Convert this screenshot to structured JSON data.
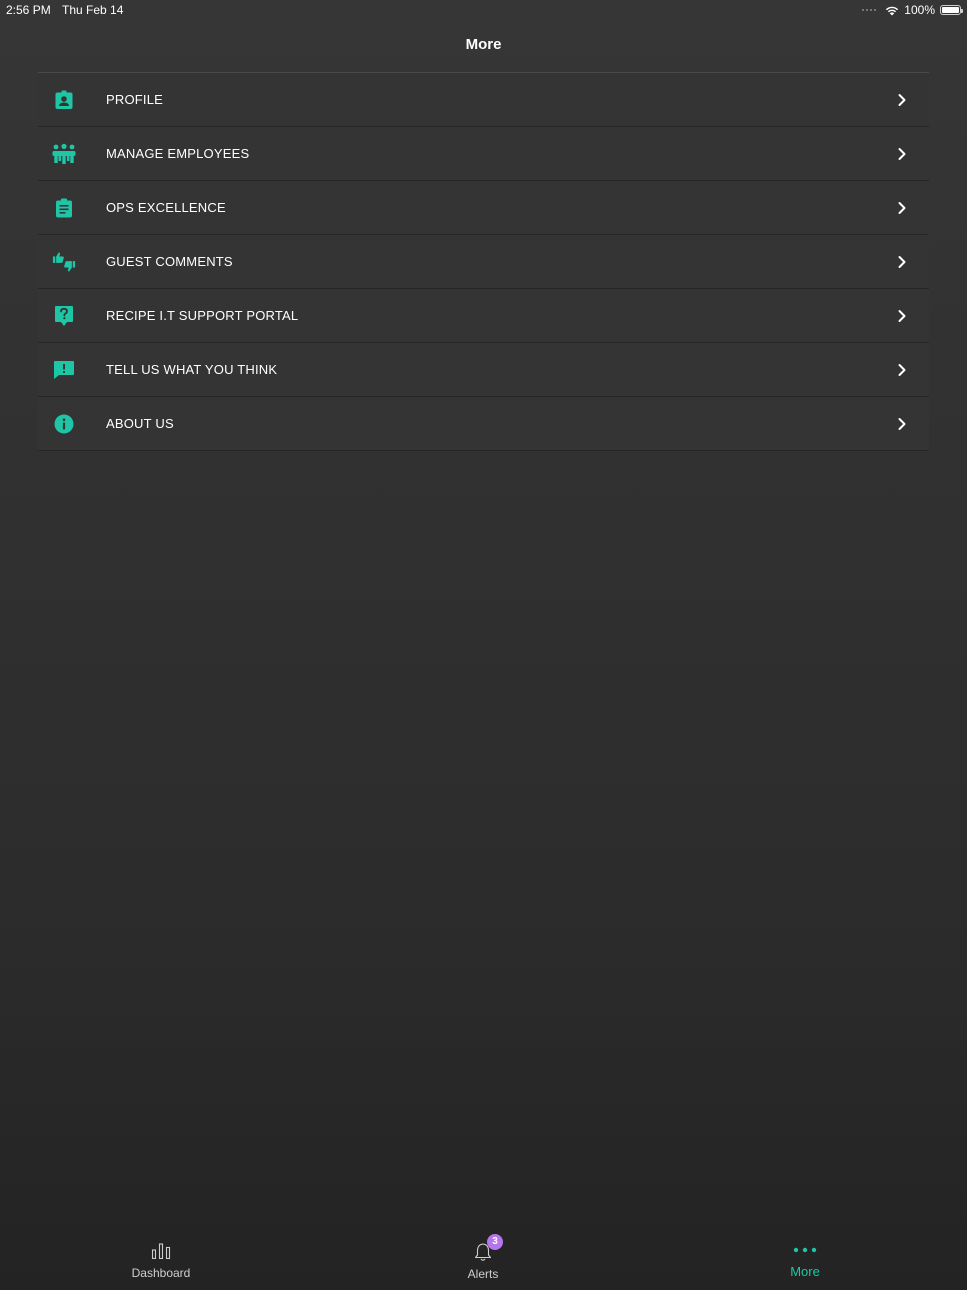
{
  "status_bar": {
    "time": "2:56 PM",
    "date": "Thu Feb 14",
    "battery": "100%"
  },
  "nav": {
    "title": "More"
  },
  "menu": {
    "items": [
      {
        "label": "PROFILE",
        "icon": "profile-badge-icon"
      },
      {
        "label": "MANAGE EMPLOYEES",
        "icon": "employees-group-icon"
      },
      {
        "label": "OPS EXCELLENCE",
        "icon": "clipboard-icon"
      },
      {
        "label": "GUEST COMMENTS",
        "icon": "thumbs-up-down-icon"
      },
      {
        "label": "RECIPE I.T SUPPORT PORTAL",
        "icon": "help-question-icon"
      },
      {
        "label": "TELL US WHAT YOU THINK",
        "icon": "feedback-chat-icon"
      },
      {
        "label": "ABOUT US",
        "icon": "info-icon"
      }
    ]
  },
  "tabs": {
    "dashboard": {
      "label": "Dashboard"
    },
    "alerts": {
      "label": "Alerts",
      "badge": "3"
    },
    "more": {
      "label": "More"
    }
  },
  "colors": {
    "accent": "#1fc6a6",
    "background": "#2f2f2f",
    "row": "#343434",
    "badge": "#b675ea"
  }
}
